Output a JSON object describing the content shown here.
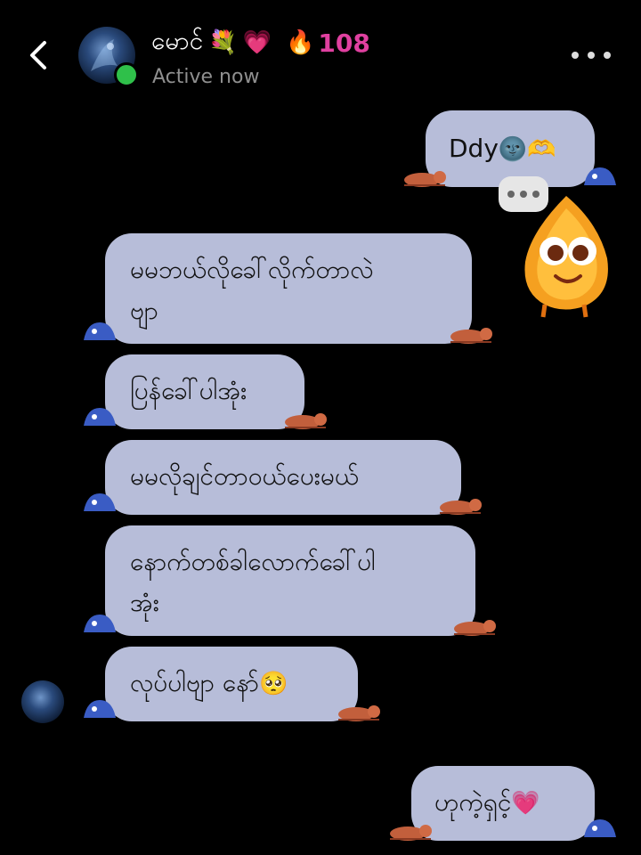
{
  "header": {
    "contact_name": "မောင်",
    "name_emojis": [
      "💐",
      "💗"
    ],
    "streak_icon": "🔥",
    "streak_count": "108",
    "status": "Active now"
  },
  "messages": [
    {
      "side": "outgoing",
      "text": "Ddy",
      "trailing_emojis": [
        "🌚",
        "🫶"
      ]
    },
    {
      "side": "incoming",
      "text": "မမဘယ်လိုခေါ်လိုက်တာလဲ\nဗျာ"
    },
    {
      "side": "incoming",
      "text": "ပြန်ခေါ်ပါအုံး"
    },
    {
      "side": "incoming",
      "text": "မမလိုချင်တာဝယ်ပေးမယ်"
    },
    {
      "side": "incoming",
      "text": "နောက်တစ်ခါလောက်ခေါ်ပါ\nအုံး"
    },
    {
      "side": "incoming",
      "text": "လုပ်ပါဗျာ နော်",
      "trailing_emojis": [
        "🥺"
      ]
    },
    {
      "side": "outgoing",
      "text": "ဟုကဲ့ရှင့်",
      "trailing_emojis": [
        "💗"
      ]
    }
  ],
  "colors": {
    "background": "#000000",
    "bubble": "#b7bdd9",
    "streak": "#e040a0",
    "online": "#2fc04a",
    "status_text": "#8f8f8f"
  },
  "icons": {
    "back": "chevron-left-icon",
    "more": "more-horizontal-icon",
    "typing": "typing-indicator-icon",
    "sticker": "flame-mascot-sticker"
  }
}
